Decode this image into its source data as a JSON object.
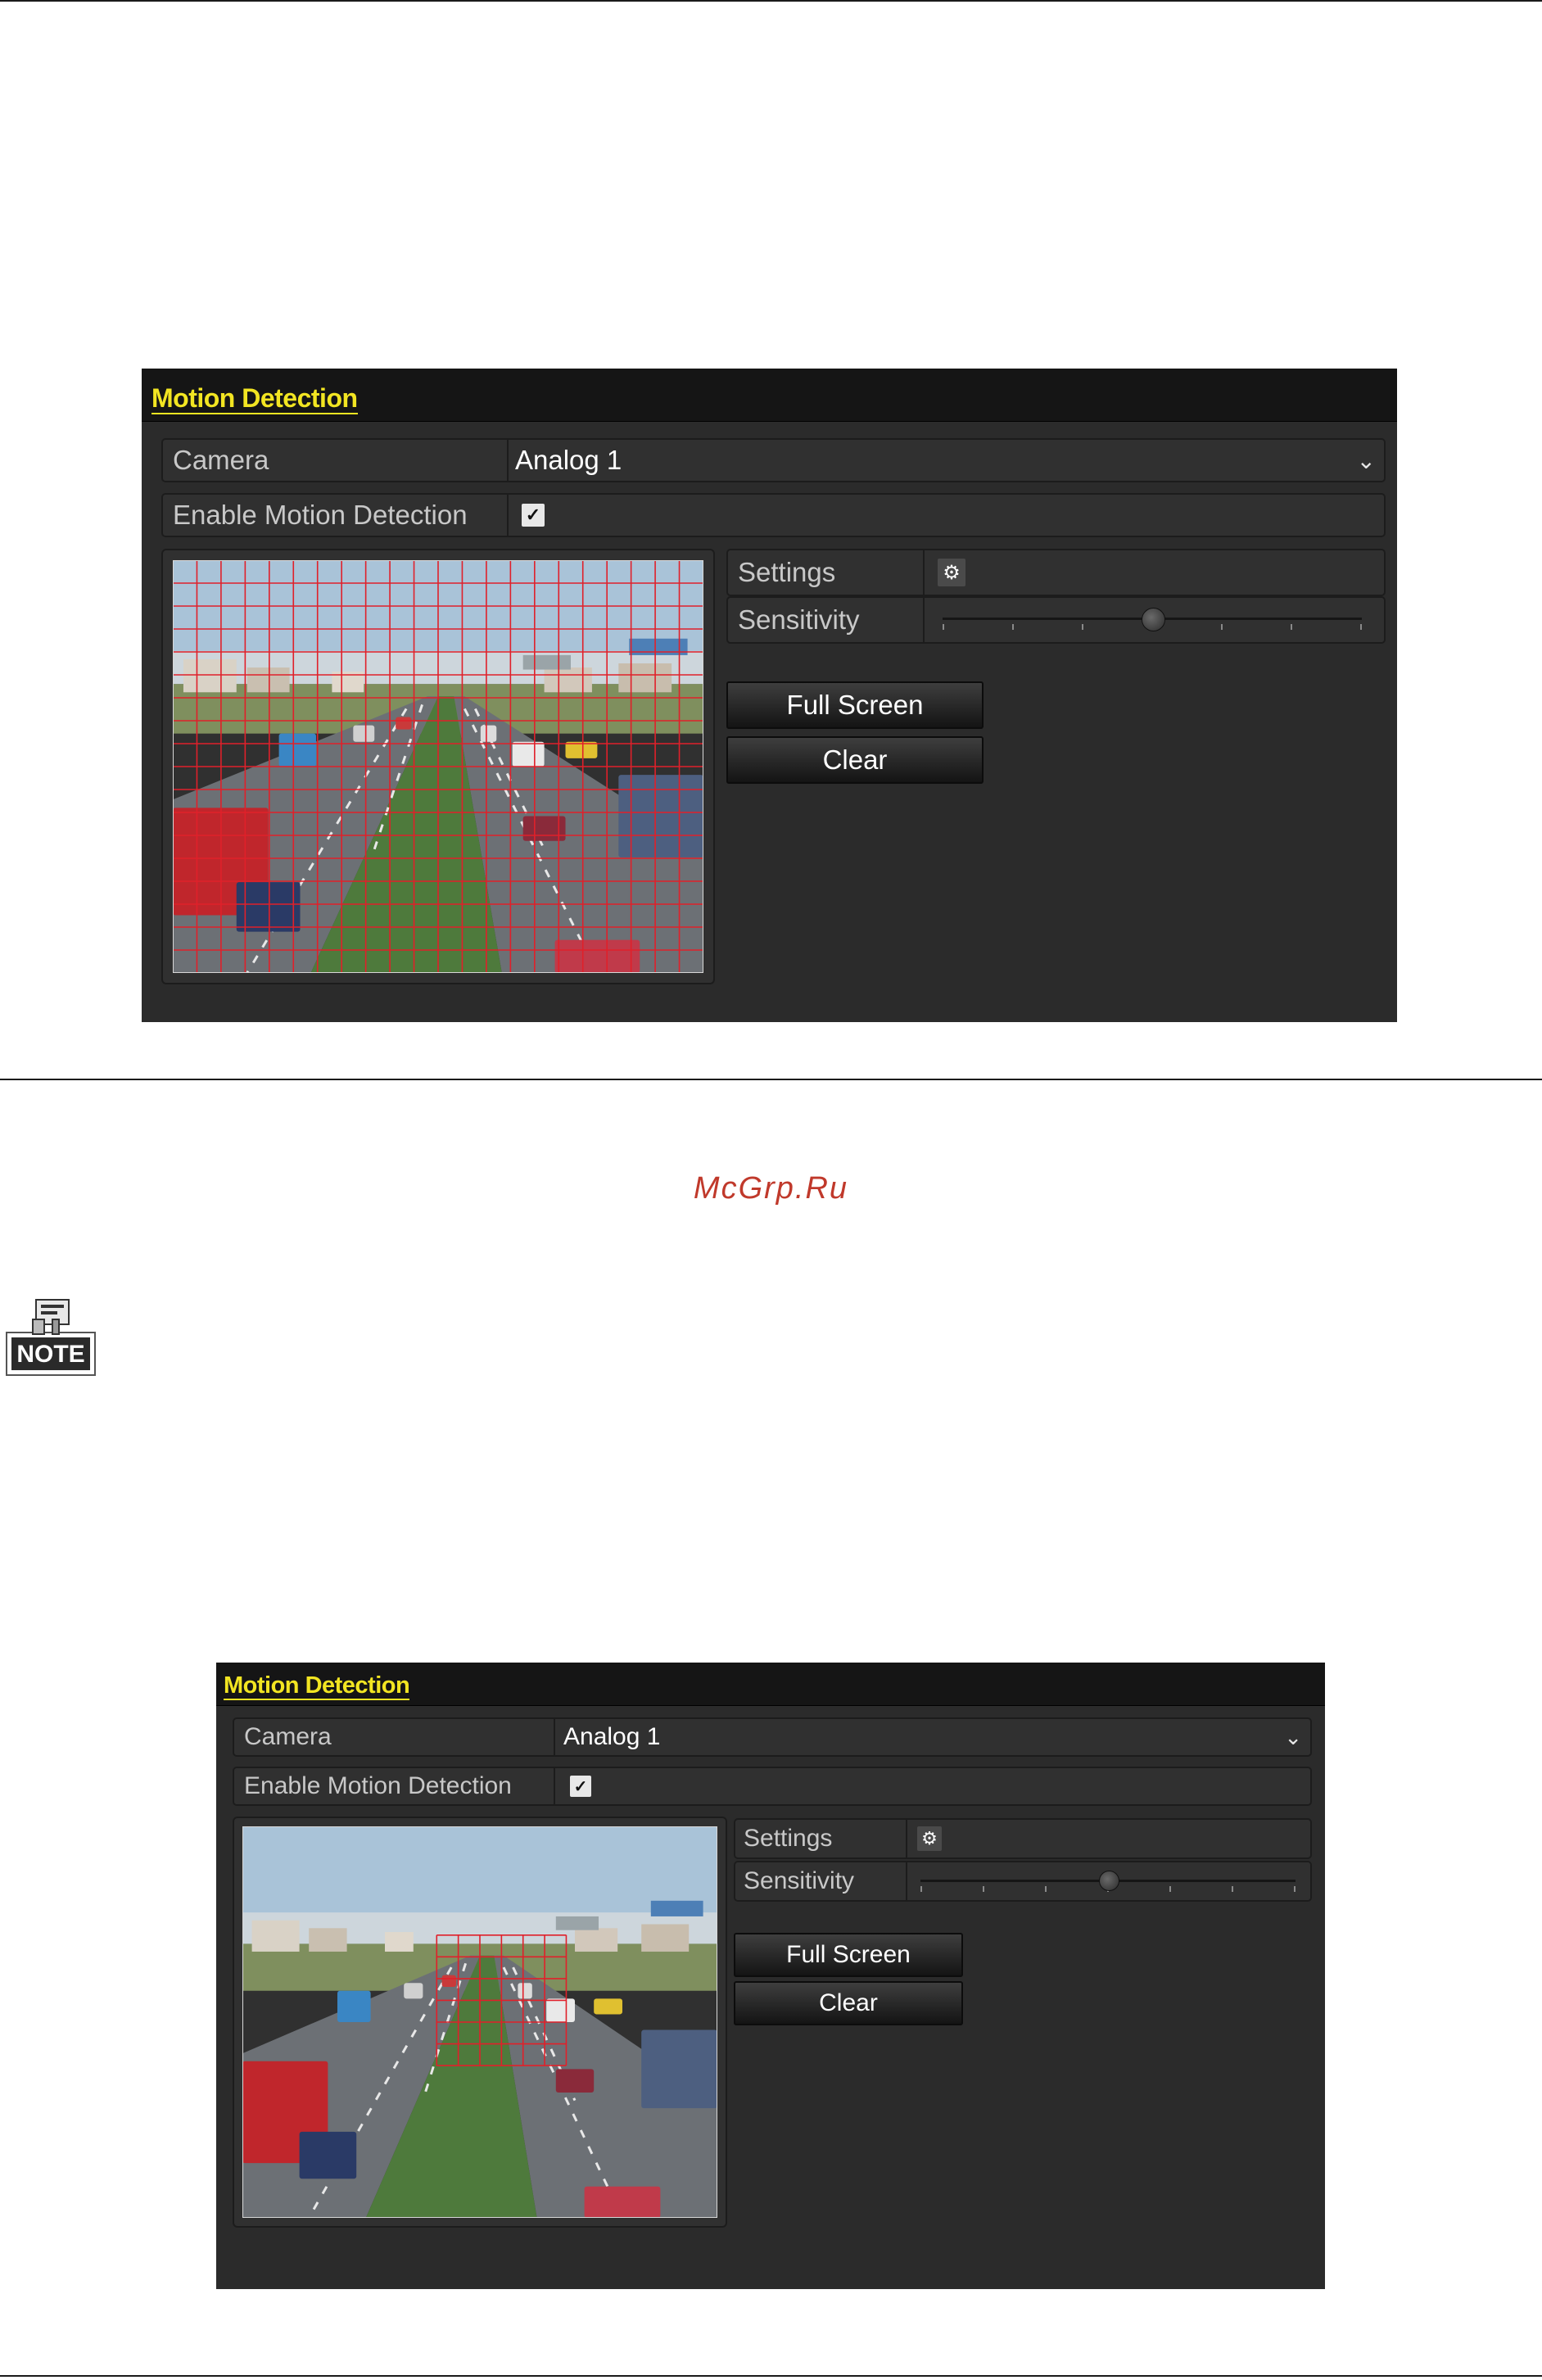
{
  "watermark": "McGrp.Ru",
  "note_icon": {
    "label": "NOTE",
    "icon": "note-icon"
  },
  "screens": [
    {
      "title": "Motion Detection",
      "camera_label": "Camera",
      "camera_value": "Analog 1",
      "enable_label": "Enable Motion Detection",
      "enable_checked": true,
      "settings_label": "Settings",
      "sensitivity_label": "Sensitivity",
      "sensitivity_level": 0.5,
      "full_screen_label": "Full Screen",
      "clear_label": "Clear",
      "grid_mode": "full"
    },
    {
      "title": "Motion Detection",
      "camera_label": "Camera",
      "camera_value": "Analog 1",
      "enable_label": "Enable Motion Detection",
      "enable_checked": true,
      "settings_label": "Settings",
      "sensitivity_label": "Sensitivity",
      "sensitivity_level": 0.5,
      "full_screen_label": "Full Screen",
      "clear_label": "Clear",
      "grid_mode": "partial"
    }
  ],
  "colors": {
    "grid": "#e0202a",
    "title": "#f2e522",
    "panel": "#2b2b2b"
  }
}
